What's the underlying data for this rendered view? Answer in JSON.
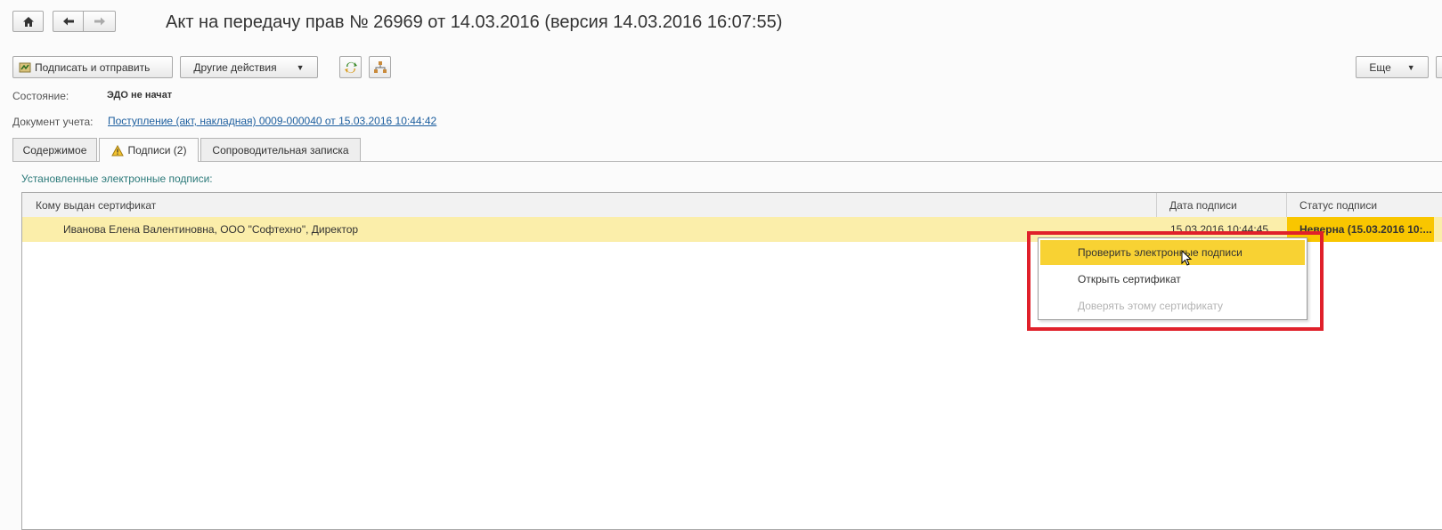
{
  "window": {
    "title": "Акт на передачу прав № 26969 от 14.03.2016 (версия 14.03.2016 16:07:55)"
  },
  "nav": {
    "home_icon": "home-icon",
    "back_icon": "arrow-left-icon",
    "forward_icon": "arrow-right-icon"
  },
  "toolbar": {
    "sign_send_label": "Подписать и отправить",
    "other_actions_label": "Другие действия",
    "more_label": "Еще"
  },
  "fields": {
    "state_label": "Состояние:",
    "state_value": "ЭДО не начат",
    "doc_label": "Документ учета:",
    "doc_link": "Поступление (акт, накладная) 0009-000040 от 15.03.2016 10:44:42"
  },
  "tabs": [
    {
      "label": "Содержимое"
    },
    {
      "label": "Подписи (2)"
    },
    {
      "label": "Сопроводительная записка"
    }
  ],
  "signatures": {
    "section_label": "Установленные электронные подписи:",
    "columns": [
      "Кому выдан сертификат",
      "Дата подписи",
      "Статус подписи"
    ],
    "rows": [
      {
        "issued_to": "Иванова Елена Валентиновна, ООО \"Софтехно\", Директор",
        "date": "15.03.2016 10:44:45",
        "status": "Неверна (15.03.2016 10:..."
      }
    ]
  },
  "context_menu": {
    "items": [
      {
        "label": "Проверить электронные подписи"
      },
      {
        "label": "Открыть сертификат"
      },
      {
        "label": "Доверять этому сертификату"
      }
    ]
  },
  "colors": {
    "row_highlight": "#fbeeaa",
    "status_cell": "#f9c600",
    "menu_highlight": "#f8d233",
    "annotation_box": "#e0202a",
    "link": "#1c5e9e"
  }
}
